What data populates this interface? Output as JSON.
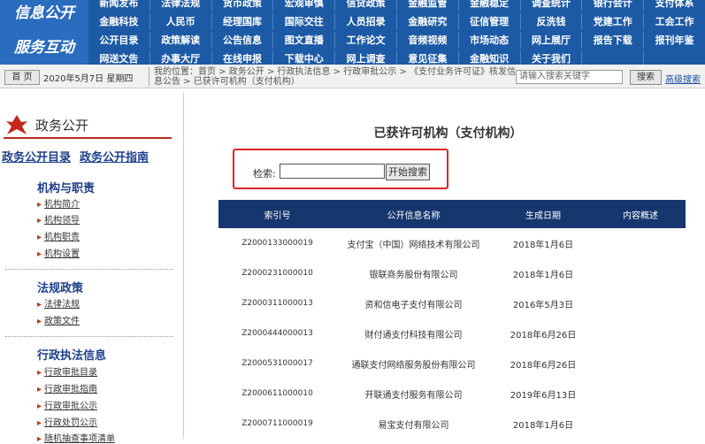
{
  "nav": {
    "brand_top": "信息公开",
    "brand_bottom": "服务互动",
    "row1": [
      "新闻发布",
      "法律法规",
      "货币政策",
      "宏观审慎",
      "信贷政策",
      "金融监管",
      "金融稳定",
      "调查统计",
      "银行会计",
      "支付体系"
    ],
    "row2": [
      "金融科技",
      "人民币",
      "经理国库",
      "国际交往",
      "人员招录",
      "金融研究",
      "征信管理",
      "反洗钱",
      "党建工作",
      "工会工作"
    ],
    "row3": [
      "公开目录",
      "政策解读",
      "公告信息",
      "图文直播",
      "工作论文",
      "音频视频",
      "市场动态",
      "网上展厅",
      "报告下载",
      "报刊年鉴"
    ],
    "row4": [
      "网送文告",
      "办事大厅",
      "在线申报",
      "下载中心",
      "网上调查",
      "意见征集",
      "金融知识",
      "关于我们"
    ]
  },
  "bar": {
    "home": "首 页",
    "date": "2020年5月7日 星期四",
    "location": "我的位置：首页 > 政务公开 > 行政执法信息 > 行政审批公示 > 《支付业务许可证》核发信息公告 > 已获许可机构（支付机构）",
    "search_placeholder": "请输入搜索关键字",
    "search_btn": "搜索",
    "advanced": "高级搜索"
  },
  "sidebar": {
    "title": "政务公开",
    "link1": "政务公开目录",
    "link2": "政务公开指南",
    "sections": [
      {
        "title": "机构与职责",
        "items": [
          "机构简介",
          "机构领导",
          "机构职责",
          "机构设置"
        ]
      },
      {
        "title": "法规政策",
        "items": [
          "法律法规",
          "政策文件"
        ]
      },
      {
        "title": "行政执法信息",
        "items": [
          "行政审批目录",
          "行政审批指南",
          "行政审批公示",
          "行政处罚公示",
          "随机抽查事项清单"
        ]
      }
    ]
  },
  "main": {
    "title": "已获许可机构（支付机构）",
    "search_label": "检索:",
    "search_value": "",
    "search_button": "开始搜索",
    "headers": [
      "索引号",
      "公开信息名称",
      "生成日期",
      "内容概述"
    ],
    "rows": [
      [
        "Z2000133000019",
        "支付宝（中国）网络技术有限公司",
        "2018年1月6日",
        ""
      ],
      [
        "Z2000231000010",
        "银联商务股份有限公司",
        "2018年1月6日",
        ""
      ],
      [
        "Z2000311000013",
        "资和信电子支付有限公司",
        "2016年5月3日",
        ""
      ],
      [
        "Z2000444000013",
        "财付通支付科技有限公司",
        "2018年6月26日",
        ""
      ],
      [
        "Z2000531000017",
        "通联支付网络服务股份有限公司",
        "2018年6月26日",
        ""
      ],
      [
        "Z2000611000010",
        "开联通支付服务有限公司",
        "2019年6月13日",
        ""
      ],
      [
        "Z2000711000019",
        "易宝支付有限公司",
        "2018年1月6日",
        ""
      ]
    ]
  },
  "colors": {
    "nav_bg": "#1d5aa6",
    "header_bg": "#16366e",
    "accent_red": "#bd2b1c",
    "highlight": "#e02424"
  }
}
